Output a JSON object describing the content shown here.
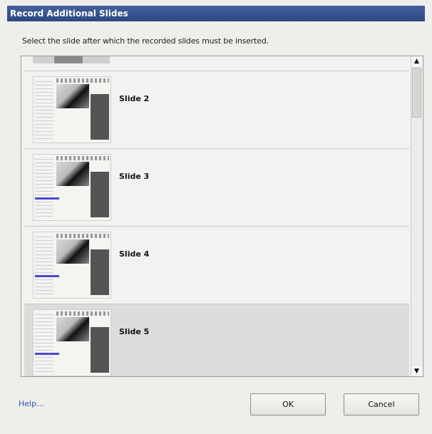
{
  "window": {
    "title": "Record Additional Slides"
  },
  "instruction": "Select the slide after which the recorded slides must be inserted.",
  "slides": [
    {
      "label": "Slide 2",
      "selected": false
    },
    {
      "label": "Slide 3",
      "selected": false
    },
    {
      "label": "Slide 4",
      "selected": false
    },
    {
      "label": "Slide 5",
      "selected": true
    }
  ],
  "help_link": "Help...",
  "buttons": {
    "ok": "OK",
    "cancel": "Cancel"
  },
  "icons": {
    "scroll_up": "arrow-up-icon",
    "scroll_down": "arrow-down-icon"
  }
}
